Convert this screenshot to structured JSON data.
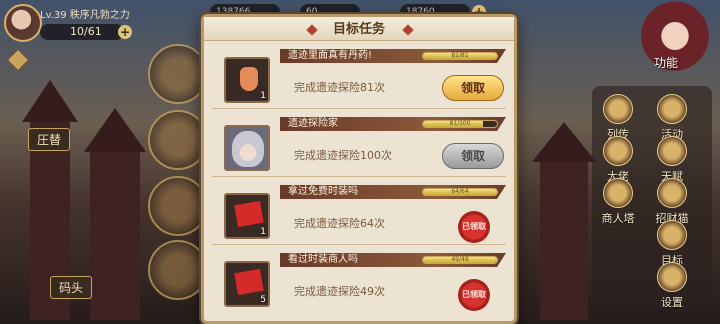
{
  "hud": {
    "level_name": "Lv.39  秩序凡勃之力",
    "energy": "10/61",
    "gold": "138766",
    "diamond": "60",
    "other": "18760"
  },
  "left_menu": {
    "castle_label": "圧替",
    "dock_label": "码头"
  },
  "right_menu": {
    "function_label": "功能",
    "items": [
      "列传",
      "活动",
      "大佬",
      "天赋",
      "商人塔",
      "招财猫",
      "目标",
      "设置"
    ]
  },
  "modal": {
    "title": "目标任务",
    "tasks": [
      {
        "name": "遗迹里面真有丹药!",
        "progress_label": "81/81",
        "progress": 1.0,
        "desc": "完成遗迹探险81次",
        "qty": "1",
        "state_label": "领取",
        "state": "claimable"
      },
      {
        "name": "遗迹探险家",
        "progress_label": "81/100",
        "progress": 0.81,
        "desc": "完成遗迹探险100次",
        "qty": "",
        "state_label": "领取",
        "state": "locked"
      },
      {
        "name": "拿过免费时装吗",
        "progress_label": "64/64",
        "progress": 1.0,
        "desc": "完成遗迹探险64次",
        "qty": "1",
        "state_label": "已领取",
        "state": "claimed"
      },
      {
        "name": "看过时装商人吗",
        "progress_label": "49/49",
        "progress": 1.0,
        "desc": "完成遗迹探险49次",
        "qty": "5",
        "state_label": "已领取",
        "state": "claimed"
      }
    ]
  },
  "colors": {
    "accent_gold": "#e7a93a",
    "claimed_red": "#d8322e",
    "panel_bg": "#ece3d3"
  }
}
